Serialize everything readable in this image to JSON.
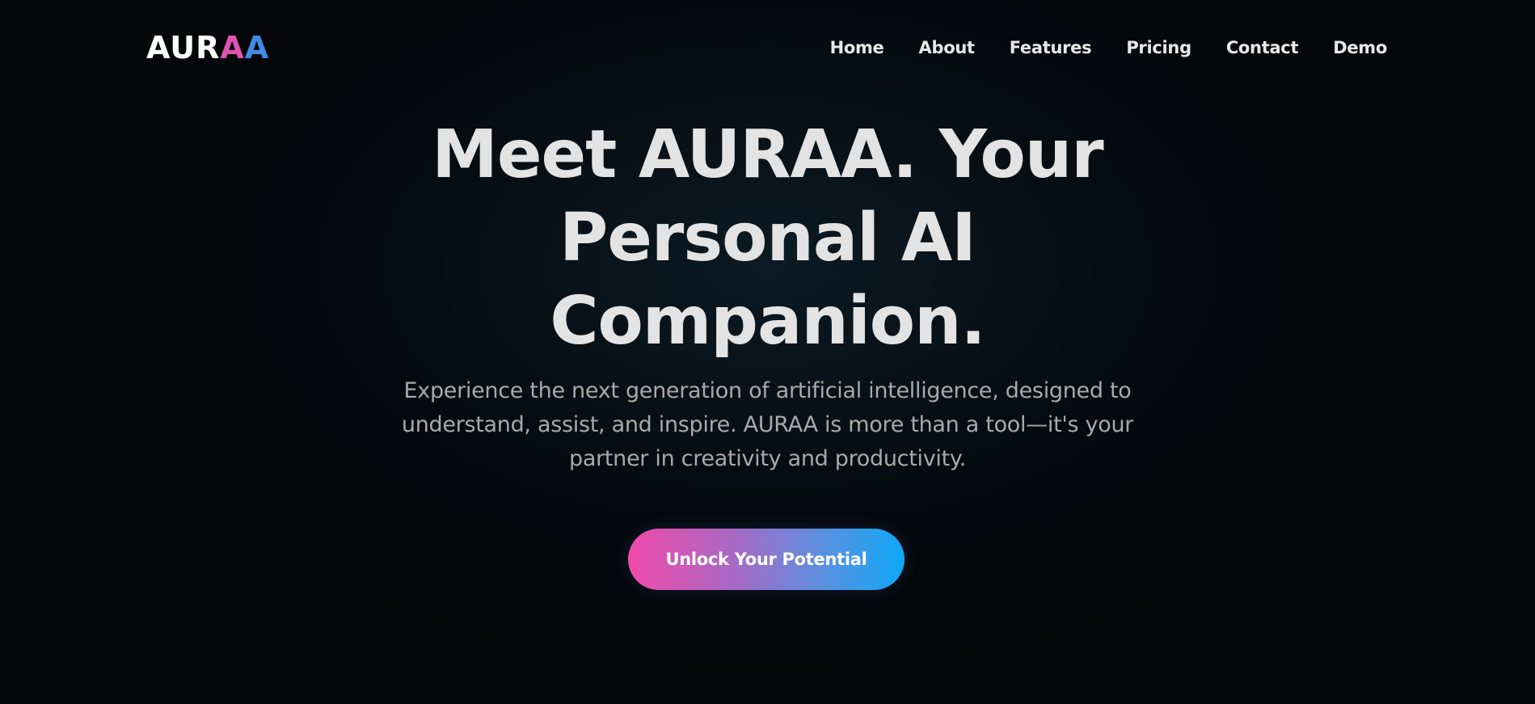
{
  "brand": {
    "logo_part1": "AUR",
    "logo_part2": "A",
    "logo_part3": "A",
    "colors": {
      "logo_pink": "#e053b0",
      "logo_blue": "#3f8be6",
      "gradient_start": "#f24aa9",
      "gradient_end": "#0ea8f6"
    }
  },
  "nav": {
    "items": [
      {
        "label": "Home"
      },
      {
        "label": "About"
      },
      {
        "label": "Features"
      },
      {
        "label": "Pricing"
      },
      {
        "label": "Contact"
      },
      {
        "label": "Demo"
      }
    ]
  },
  "hero": {
    "title": "Meet AURAA. Your Personal AI Companion.",
    "subtitle": "Experience the next generation of artificial intelligence, designed to understand, assist, and inspire. AURAA is more than a tool—it's your partner in creativity and productivity.",
    "cta_label": "Unlock Your Potential"
  }
}
